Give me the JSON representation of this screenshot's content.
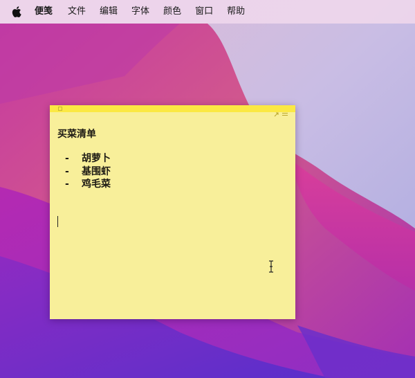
{
  "menubar": {
    "apple_icon": "apple-logo-icon",
    "app_name": "便笺",
    "items": [
      "文件",
      "编辑",
      "字体",
      "颜色",
      "窗口",
      "帮助"
    ]
  },
  "note": {
    "color": "#f8ef9a",
    "titlebar_color": "#fbe843",
    "heading": "买菜清单",
    "bullet": "-",
    "items": [
      "胡萝卜",
      "基围虾",
      "鸡毛菜"
    ]
  }
}
